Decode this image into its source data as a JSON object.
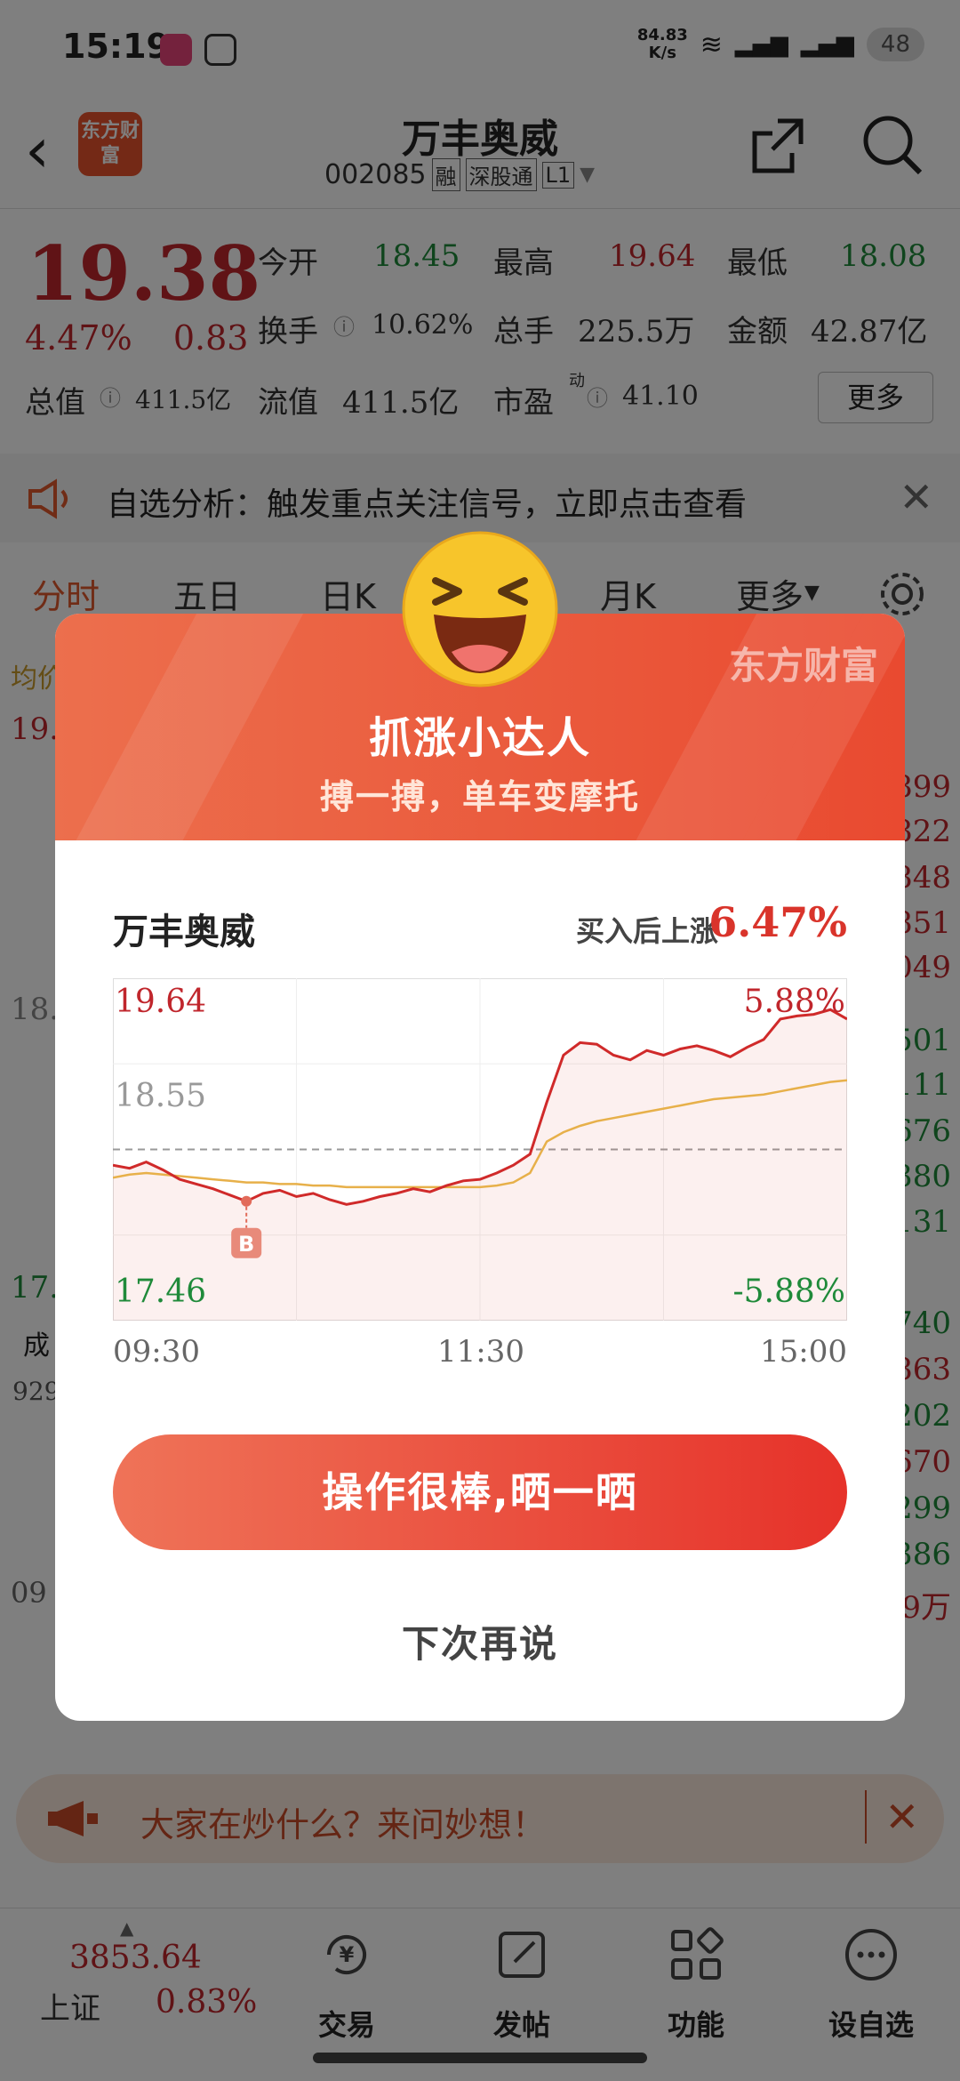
{
  "status_bar": {
    "time": "15:19",
    "net_speed": "84.83",
    "net_unit": "K/s",
    "battery": "48"
  },
  "header": {
    "title": "万丰奥威",
    "code": "002085",
    "tags": [
      "融",
      "深股通",
      "L1"
    ],
    "logo_text": "东方财富"
  },
  "quote": {
    "price": "19.38",
    "change_pct": "4.47%",
    "change": "0.83",
    "open_label": "今开",
    "open": "18.45",
    "high_label": "最高",
    "high": "19.64",
    "low_label": "最低",
    "low": "18.08",
    "turnover_label": "换手",
    "turnover": "10.62%",
    "volume_label": "总手",
    "volume": "225.5万",
    "amount_label": "金额",
    "amount": "42.87亿",
    "mcap_label": "总值",
    "mcap": "411.5亿",
    "float_label": "流值",
    "float": "411.5亿",
    "pe_label": "市盈",
    "pe_sup": "动",
    "pe": "41.10",
    "more_label": "更多"
  },
  "notice": {
    "text": "自选分析：触发重点关注信号，立即点击查看"
  },
  "tabs": [
    "分时",
    "五日",
    "日K",
    "月K",
    "更多"
  ],
  "bg_right_values": [
    "899",
    "822",
    "848",
    "851",
    "049",
    "501",
    "111",
    "676",
    "380",
    "131",
    "740",
    "863",
    "202",
    "670",
    "299",
    "386",
    "9万"
  ],
  "bg_left": {
    "v1": "19.",
    "v2": "18.",
    "v3": "17.",
    "vol_label": "成",
    "vol_val": "929",
    "time": "09",
    "avg_label": "均价"
  },
  "banner": {
    "text": "大家在炒什么？来问妙想！"
  },
  "bottom": {
    "index_value": "3853.64",
    "index_name": "上证",
    "index_change": "0.83%",
    "nav": [
      "交易",
      "发帖",
      "功能",
      "设自选"
    ]
  },
  "modal": {
    "brand": "东方财富",
    "title": "抓涨小达人",
    "subtitle": "搏一搏，单车变摩托",
    "stock_name": "万丰奥威",
    "gain_label": "买入后上涨",
    "gain_value": "6.47%",
    "cta_label": "操作很棒,晒一晒",
    "later_label": "下次再说",
    "buy_marker": "B"
  },
  "chart_data": {
    "type": "line",
    "title": "",
    "y_max_label": "19.64",
    "y_mid_label": "18.55",
    "y_min_label": "17.46",
    "pct_max_label": "5.88%",
    "pct_min_label": "-5.88%",
    "x_labels": [
      "09:30",
      "11:30",
      "15:00"
    ],
    "ylim": [
      17.46,
      19.64
    ],
    "prev_close": 18.55,
    "buy_index": 8,
    "series": [
      {
        "role": "price",
        "color": "#d02a2a",
        "values": [
          18.45,
          18.43,
          18.47,
          18.42,
          18.36,
          18.33,
          18.3,
          18.26,
          18.22,
          18.27,
          18.29,
          18.25,
          18.27,
          18.23,
          18.2,
          18.22,
          18.25,
          18.27,
          18.3,
          18.28,
          18.32,
          18.35,
          18.36,
          18.4,
          18.45,
          18.52,
          18.85,
          19.15,
          19.23,
          19.22,
          19.15,
          19.12,
          19.18,
          19.15,
          19.19,
          19.21,
          19.18,
          19.14,
          19.2,
          19.25,
          19.38,
          19.4,
          19.41,
          19.44,
          19.38
        ]
      },
      {
        "role": "average",
        "color": "#e7b04a",
        "values": [
          18.37,
          18.39,
          18.4,
          18.39,
          18.38,
          18.37,
          18.36,
          18.35,
          18.34,
          18.34,
          18.33,
          18.33,
          18.32,
          18.32,
          18.31,
          18.31,
          18.31,
          18.31,
          18.31,
          18.31,
          18.31,
          18.31,
          18.31,
          18.32,
          18.34,
          18.4,
          18.6,
          18.66,
          18.7,
          18.73,
          18.75,
          18.77,
          18.79,
          18.81,
          18.83,
          18.85,
          18.87,
          18.88,
          18.89,
          18.9,
          18.92,
          18.94,
          18.96,
          18.98,
          18.99
        ]
      }
    ]
  }
}
